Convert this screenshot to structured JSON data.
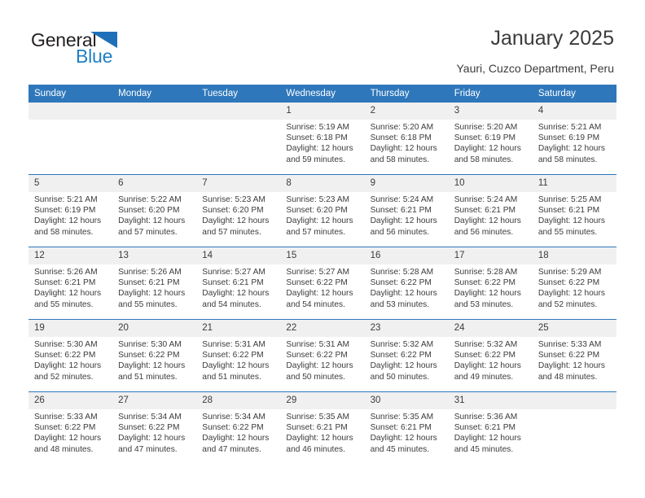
{
  "logo": {
    "text_primary": "General",
    "text_secondary": "Blue",
    "triangle_color": "#1d70b8",
    "secondary_color": "#1f7fc4"
  },
  "header": {
    "title": "January 2025",
    "subtitle": "Yauri, Cuzco Department, Peru"
  },
  "theme": {
    "header_band": "#2e77bb",
    "daynum_band": "#f0f0f0",
    "text": "#3b3b3b"
  },
  "calendar": {
    "weekday_headers": [
      "Sunday",
      "Monday",
      "Tuesday",
      "Wednesday",
      "Thursday",
      "Friday",
      "Saturday"
    ],
    "weeks": [
      [
        {
          "day": "",
          "empty": true
        },
        {
          "day": "",
          "empty": true
        },
        {
          "day": "",
          "empty": true
        },
        {
          "day": "1",
          "sunrise": "Sunrise: 5:19 AM",
          "sunset": "Sunset: 6:18 PM",
          "daylight_1": "Daylight: 12 hours",
          "daylight_2": "and 59 minutes."
        },
        {
          "day": "2",
          "sunrise": "Sunrise: 5:20 AM",
          "sunset": "Sunset: 6:18 PM",
          "daylight_1": "Daylight: 12 hours",
          "daylight_2": "and 58 minutes."
        },
        {
          "day": "3",
          "sunrise": "Sunrise: 5:20 AM",
          "sunset": "Sunset: 6:19 PM",
          "daylight_1": "Daylight: 12 hours",
          "daylight_2": "and 58 minutes."
        },
        {
          "day": "4",
          "sunrise": "Sunrise: 5:21 AM",
          "sunset": "Sunset: 6:19 PM",
          "daylight_1": "Daylight: 12 hours",
          "daylight_2": "and 58 minutes."
        }
      ],
      [
        {
          "day": "5",
          "sunrise": "Sunrise: 5:21 AM",
          "sunset": "Sunset: 6:19 PM",
          "daylight_1": "Daylight: 12 hours",
          "daylight_2": "and 58 minutes."
        },
        {
          "day": "6",
          "sunrise": "Sunrise: 5:22 AM",
          "sunset": "Sunset: 6:20 PM",
          "daylight_1": "Daylight: 12 hours",
          "daylight_2": "and 57 minutes."
        },
        {
          "day": "7",
          "sunrise": "Sunrise: 5:23 AM",
          "sunset": "Sunset: 6:20 PM",
          "daylight_1": "Daylight: 12 hours",
          "daylight_2": "and 57 minutes."
        },
        {
          "day": "8",
          "sunrise": "Sunrise: 5:23 AM",
          "sunset": "Sunset: 6:20 PM",
          "daylight_1": "Daylight: 12 hours",
          "daylight_2": "and 57 minutes."
        },
        {
          "day": "9",
          "sunrise": "Sunrise: 5:24 AM",
          "sunset": "Sunset: 6:21 PM",
          "daylight_1": "Daylight: 12 hours",
          "daylight_2": "and 56 minutes."
        },
        {
          "day": "10",
          "sunrise": "Sunrise: 5:24 AM",
          "sunset": "Sunset: 6:21 PM",
          "daylight_1": "Daylight: 12 hours",
          "daylight_2": "and 56 minutes."
        },
        {
          "day": "11",
          "sunrise": "Sunrise: 5:25 AM",
          "sunset": "Sunset: 6:21 PM",
          "daylight_1": "Daylight: 12 hours",
          "daylight_2": "and 55 minutes."
        }
      ],
      [
        {
          "day": "12",
          "sunrise": "Sunrise: 5:26 AM",
          "sunset": "Sunset: 6:21 PM",
          "daylight_1": "Daylight: 12 hours",
          "daylight_2": "and 55 minutes."
        },
        {
          "day": "13",
          "sunrise": "Sunrise: 5:26 AM",
          "sunset": "Sunset: 6:21 PM",
          "daylight_1": "Daylight: 12 hours",
          "daylight_2": "and 55 minutes."
        },
        {
          "day": "14",
          "sunrise": "Sunrise: 5:27 AM",
          "sunset": "Sunset: 6:21 PM",
          "daylight_1": "Daylight: 12 hours",
          "daylight_2": "and 54 minutes."
        },
        {
          "day": "15",
          "sunrise": "Sunrise: 5:27 AM",
          "sunset": "Sunset: 6:22 PM",
          "daylight_1": "Daylight: 12 hours",
          "daylight_2": "and 54 minutes."
        },
        {
          "day": "16",
          "sunrise": "Sunrise: 5:28 AM",
          "sunset": "Sunset: 6:22 PM",
          "daylight_1": "Daylight: 12 hours",
          "daylight_2": "and 53 minutes."
        },
        {
          "day": "17",
          "sunrise": "Sunrise: 5:28 AM",
          "sunset": "Sunset: 6:22 PM",
          "daylight_1": "Daylight: 12 hours",
          "daylight_2": "and 53 minutes."
        },
        {
          "day": "18",
          "sunrise": "Sunrise: 5:29 AM",
          "sunset": "Sunset: 6:22 PM",
          "daylight_1": "Daylight: 12 hours",
          "daylight_2": "and 52 minutes."
        }
      ],
      [
        {
          "day": "19",
          "sunrise": "Sunrise: 5:30 AM",
          "sunset": "Sunset: 6:22 PM",
          "daylight_1": "Daylight: 12 hours",
          "daylight_2": "and 52 minutes."
        },
        {
          "day": "20",
          "sunrise": "Sunrise: 5:30 AM",
          "sunset": "Sunset: 6:22 PM",
          "daylight_1": "Daylight: 12 hours",
          "daylight_2": "and 51 minutes."
        },
        {
          "day": "21",
          "sunrise": "Sunrise: 5:31 AM",
          "sunset": "Sunset: 6:22 PM",
          "daylight_1": "Daylight: 12 hours",
          "daylight_2": "and 51 minutes."
        },
        {
          "day": "22",
          "sunrise": "Sunrise: 5:31 AM",
          "sunset": "Sunset: 6:22 PM",
          "daylight_1": "Daylight: 12 hours",
          "daylight_2": "and 50 minutes."
        },
        {
          "day": "23",
          "sunrise": "Sunrise: 5:32 AM",
          "sunset": "Sunset: 6:22 PM",
          "daylight_1": "Daylight: 12 hours",
          "daylight_2": "and 50 minutes."
        },
        {
          "day": "24",
          "sunrise": "Sunrise: 5:32 AM",
          "sunset": "Sunset: 6:22 PM",
          "daylight_1": "Daylight: 12 hours",
          "daylight_2": "and 49 minutes."
        },
        {
          "day": "25",
          "sunrise": "Sunrise: 5:33 AM",
          "sunset": "Sunset: 6:22 PM",
          "daylight_1": "Daylight: 12 hours",
          "daylight_2": "and 48 minutes."
        }
      ],
      [
        {
          "day": "26",
          "sunrise": "Sunrise: 5:33 AM",
          "sunset": "Sunset: 6:22 PM",
          "daylight_1": "Daylight: 12 hours",
          "daylight_2": "and 48 minutes."
        },
        {
          "day": "27",
          "sunrise": "Sunrise: 5:34 AM",
          "sunset": "Sunset: 6:22 PM",
          "daylight_1": "Daylight: 12 hours",
          "daylight_2": "and 47 minutes."
        },
        {
          "day": "28",
          "sunrise": "Sunrise: 5:34 AM",
          "sunset": "Sunset: 6:22 PM",
          "daylight_1": "Daylight: 12 hours",
          "daylight_2": "and 47 minutes."
        },
        {
          "day": "29",
          "sunrise": "Sunrise: 5:35 AM",
          "sunset": "Sunset: 6:21 PM",
          "daylight_1": "Daylight: 12 hours",
          "daylight_2": "and 46 minutes."
        },
        {
          "day": "30",
          "sunrise": "Sunrise: 5:35 AM",
          "sunset": "Sunset: 6:21 PM",
          "daylight_1": "Daylight: 12 hours",
          "daylight_2": "and 45 minutes."
        },
        {
          "day": "31",
          "sunrise": "Sunrise: 5:36 AM",
          "sunset": "Sunset: 6:21 PM",
          "daylight_1": "Daylight: 12 hours",
          "daylight_2": "and 45 minutes."
        },
        {
          "day": "",
          "empty": true
        }
      ]
    ]
  }
}
